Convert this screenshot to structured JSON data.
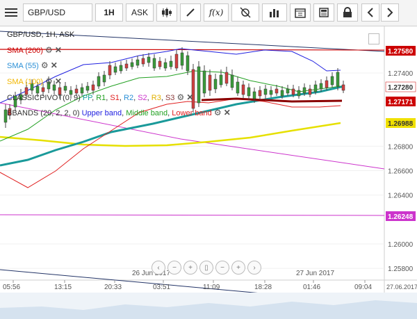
{
  "toolbar": {
    "menu_icon": "hamburger-icon",
    "symbol": "GBP/USD",
    "timeframe": "1H",
    "price_side": "ASK",
    "buttons": [
      "candlestick-icon",
      "draw-icon",
      "fx-icon",
      "crosshair-icon",
      "bar-chart-icon",
      "calendar-icon",
      "news-icon",
      "lock-icon",
      "prev-icon",
      "next-icon"
    ],
    "fx_label": "f(x)"
  },
  "chart": {
    "header": "GBP/USD, 1H, ASK",
    "indicators": {
      "sma200": "SMA (200)",
      "sma55": "SMA (55)",
      "sma100": "SMA (100)",
      "pivot_prefix": "CLASSICPIVOT(0, 9)",
      "pivot_parts": [
        "PP",
        "R1",
        "S1",
        "R2",
        "S2",
        "R3",
        "S3"
      ],
      "bbands_prefix": "BBANDS (20, 2, 2, 0)",
      "bbands_upper": "Upper band",
      "bbands_middle": "Middle band",
      "bbands_lower": "Lower band"
    },
    "price_axis": {
      "ticks": [
        "1.27400",
        "1.26800",
        "1.26600",
        "1.26400",
        "1.26000",
        "1.25800"
      ],
      "markers": [
        {
          "label": "1.27580",
          "color": "#cc0000",
          "text_color": "#ffffff"
        },
        {
          "label": "1.27280",
          "color": "#ffffff",
          "text_color": "#333333"
        },
        {
          "label": "1.27171",
          "color": "#cc0000",
          "text_color": "#ffffff"
        },
        {
          "label": "1.26988",
          "color": "#f0e000",
          "text_color": "#333333"
        },
        {
          "label": "1.26248",
          "color": "#cc33cc",
          "text_color": "#ffffff"
        }
      ]
    },
    "time_axis": {
      "ticks": [
        "05:56",
        "13:15",
        "20:33",
        "03:51",
        "11:09",
        "18:28",
        "01:46",
        "09:04"
      ],
      "end_label": "27.06.2017",
      "date_labels": [
        "26 Jun 2017",
        "27 Jun 2017"
      ]
    },
    "colors": {
      "sma200": "#cc0000",
      "sma55": "#2a8fd6",
      "sma100": "#f2b700",
      "teal": "#1a9a9a",
      "bb_upper": "#2020e0",
      "bb_middle": "#22a022",
      "bb_lower": "#e02020",
      "pivot_pp": "#8b0000",
      "yellow_ma": "#e6e000",
      "magenta": "#cc33cc",
      "candle_up": "#3b9a3b",
      "candle_down": "#d04040"
    }
  }
}
